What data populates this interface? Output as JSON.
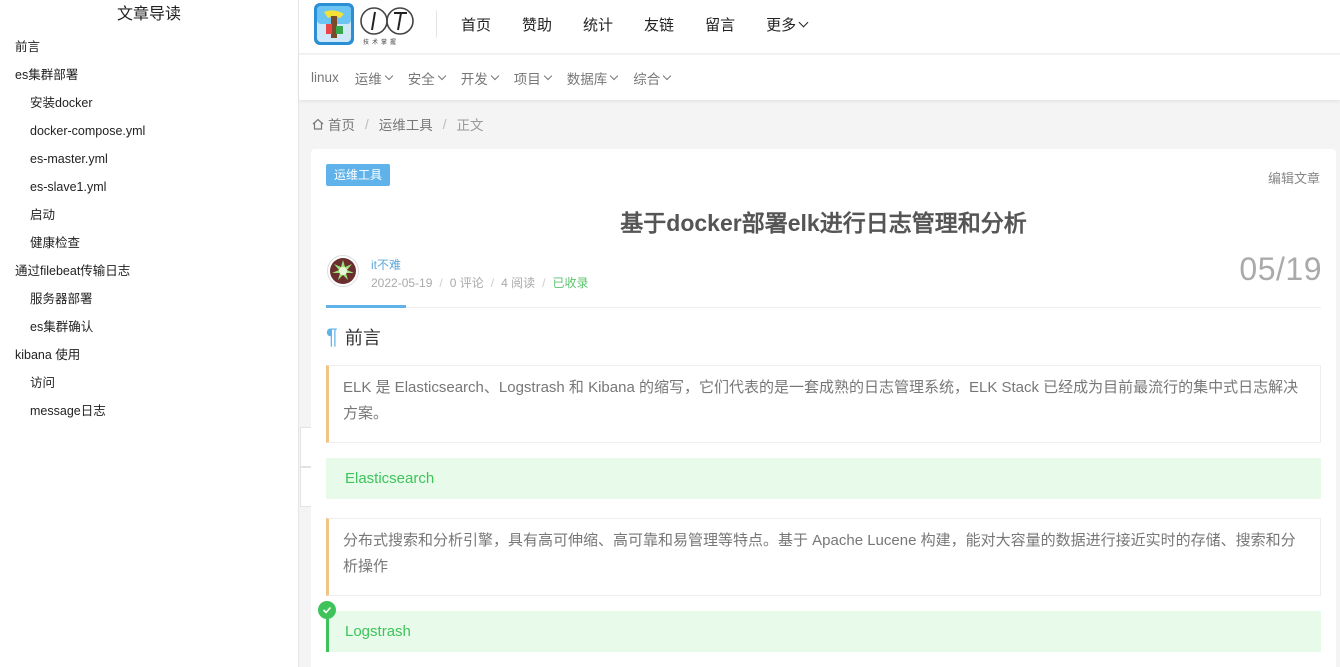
{
  "toc": {
    "title": "文章导读",
    "items": [
      {
        "label": "前言",
        "level": 1
      },
      {
        "label": "es集群部署",
        "level": 1
      },
      {
        "label": "安装docker",
        "level": 2
      },
      {
        "label": "docker-compose.yml",
        "level": 2
      },
      {
        "label": "es-master.yml",
        "level": 2
      },
      {
        "label": "es-slave1.yml",
        "level": 2
      },
      {
        "label": "启动",
        "level": 2
      },
      {
        "label": "健康检查",
        "level": 2
      },
      {
        "label": "通过filebeat传输日志",
        "level": 1
      },
      {
        "label": "服务器部署",
        "level": 2
      },
      {
        "label": "es集群确认",
        "level": 2
      },
      {
        "label": "kibana 使用",
        "level": 1
      },
      {
        "label": "访问",
        "level": 2
      },
      {
        "label": "message日志",
        "level": 2
      }
    ]
  },
  "header": {
    "nav": [
      {
        "label": "首页"
      },
      {
        "label": "赞助"
      },
      {
        "label": "统计"
      },
      {
        "label": "友链"
      },
      {
        "label": "留言"
      },
      {
        "label": "更多",
        "dropdown": true
      }
    ]
  },
  "subnav": [
    {
      "label": "linux",
      "dropdown": false
    },
    {
      "label": "运维",
      "dropdown": true
    },
    {
      "label": "安全",
      "dropdown": true
    },
    {
      "label": "开发",
      "dropdown": true
    },
    {
      "label": "项目",
      "dropdown": true
    },
    {
      "label": "数据库",
      "dropdown": true
    },
    {
      "label": "综合",
      "dropdown": true
    }
  ],
  "breadcrumb": {
    "home": "首页",
    "category": "运维工具",
    "current": "正文"
  },
  "article": {
    "category_badge": "运维工具",
    "edit_label": "编辑文章",
    "title": "基于docker部署elk进行日志管理和分析",
    "author": "it不难",
    "date": "2022-05-19",
    "comments": "0 评论",
    "reads": "4 阅读",
    "indexed": "已收录",
    "date_big": "05/19",
    "heading_preface": "前言",
    "quote1": "ELK 是 Elasticsearch、Logstrash 和 Kibana 的缩写，它们代表的是一套成熟的日志管理系统，ELK Stack 已经成为目前最流行的集中式日志解决方案。",
    "note1": "Elasticsearch",
    "quote2": "分布式搜索和分析引擎，具有高可伸缩、高可靠和易管理等特点。基于 Apache Lucene 构建，能对大容量的数据进行接近实时的存储、搜索和分析操作",
    "note2": "Logstrash"
  },
  "colors": {
    "accent": "#5fb2ea",
    "quote_border": "#f2c387",
    "note_green": "#3ec35b",
    "note_bg": "#e8fbea"
  },
  "icons": {
    "toc_toggle": "hamburger-icon",
    "to_top": "arrow-up-icon",
    "home": "home-icon",
    "check": "check-circle-icon"
  }
}
